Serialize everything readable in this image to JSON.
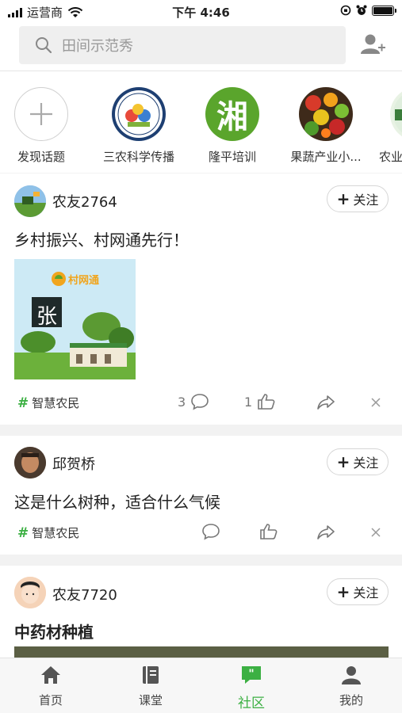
{
  "status_bar": {
    "carrier": "运营商",
    "time": "下午 4:46"
  },
  "search": {
    "placeholder": "田间示范秀"
  },
  "topics": [
    {
      "label": "发现话题",
      "icon": "plus-icon"
    },
    {
      "label": "三农科学传播",
      "icon": "science-logo"
    },
    {
      "label": "隆平培训",
      "icon": "xiang-logo",
      "logo_text": "湘"
    },
    {
      "label": "果蔬产业小...",
      "icon": "fruit-image"
    },
    {
      "label": "农业",
      "icon": "partial-logo"
    }
  ],
  "posts": [
    {
      "user": "农友2764",
      "follow": "关注",
      "text": "乡村振兴、村网通先行！",
      "image_caption": "村网通",
      "image_sign": "张",
      "tag": "智慧农民",
      "comments": "3",
      "likes": "1"
    },
    {
      "user": "邱贺桥",
      "follow": "关注",
      "text": "这是什么树种，适合什么气候",
      "tag": "智慧农民"
    },
    {
      "user": "农友7720",
      "follow": "关注",
      "text": "中药材种植"
    }
  ],
  "tabs": [
    {
      "label": "首页",
      "icon": "home-icon"
    },
    {
      "label": "课堂",
      "icon": "book-icon"
    },
    {
      "label": "社区",
      "icon": "community-icon",
      "active": true
    },
    {
      "label": "我的",
      "icon": "person-icon"
    }
  ],
  "colors": {
    "accent": "#3cb043"
  }
}
